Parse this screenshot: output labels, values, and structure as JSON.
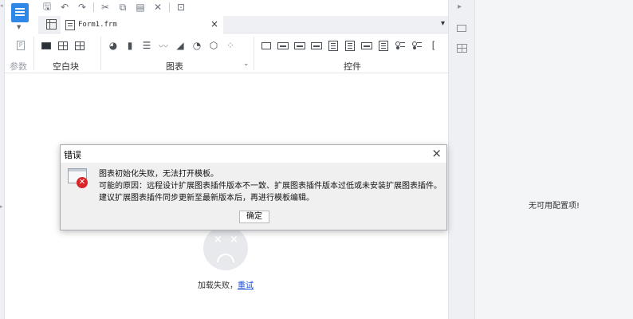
{
  "tab": {
    "filename": "Form1.frm"
  },
  "ribbon": {
    "groups": [
      {
        "label": "参数"
      },
      {
        "label": "空白块"
      },
      {
        "label": "图表"
      },
      {
        "label": "控件"
      }
    ],
    "params_icon_glyph": "P"
  },
  "canvas": {
    "load_failed_text": "加载失败，",
    "retry_link": "重试"
  },
  "config_pane": {
    "message": "无可用配置项!"
  },
  "dialog": {
    "title": "错误",
    "lines": [
      "图表初始化失败，无法打开模板。",
      "可能的原因：远程设计扩展图表插件版本不一致、扩展图表插件版本过低或未安装扩展图表插件。",
      "建议扩展图表插件同步更新至最新版本后，再进行模板编辑。"
    ],
    "ok_button": "确定"
  },
  "icons": {
    "app": "report-designer-logo-icon",
    "save": "save-icon",
    "undo": "undo-icon",
    "redo": "redo-icon",
    "cut": "cut-icon",
    "copy": "copy-icon",
    "paste": "paste-icon",
    "delete": "delete-icon",
    "format": "format-icon",
    "error": "error-icon"
  },
  "colors": {
    "accent": "#2f88e8",
    "error": "#d9252a",
    "link": "#1a4fd6"
  }
}
